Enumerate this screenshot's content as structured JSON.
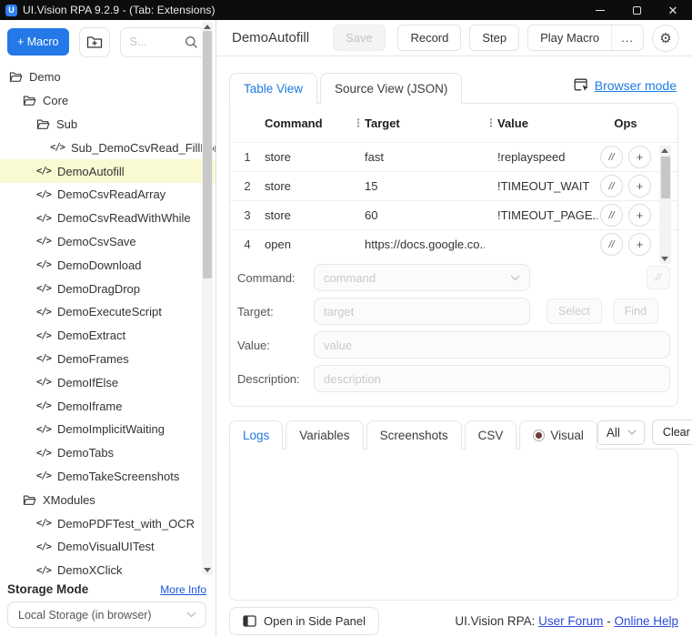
{
  "title_bar": {
    "app_logo_glyph": "U",
    "title": "UI.Vision RPA 9.2.9 - (Tab: Extensions)",
    "window_controls": {
      "minimize": "minimize",
      "maximize": "maximize",
      "close": "✕"
    }
  },
  "colors": {
    "accent_blue": "#2478e8",
    "active_tab_blue": "#1f7ae2",
    "link_blue": "#1e7be2",
    "selected_row_yellow": "#fafad2",
    "visual_radio_maroon": "#6e3b36",
    "titlebar_black": "#0d0d0d"
  },
  "sidebar": {
    "toolbar": {
      "new_macro_label": "+ Macro",
      "search_placeholder": "S..."
    },
    "tree": [
      {
        "label": "Demo",
        "type": "folder",
        "depth": 0
      },
      {
        "label": "Core",
        "type": "folder",
        "depth": 1
      },
      {
        "label": "Sub",
        "type": "folder",
        "depth": 2
      },
      {
        "label": "Sub_DemoCsvRead_FillFor",
        "type": "macro",
        "depth": 3
      },
      {
        "label": "DemoAutofill",
        "type": "macro",
        "depth": 2,
        "selected": true
      },
      {
        "label": "DemoCsvReadArray",
        "type": "macro",
        "depth": 2
      },
      {
        "label": "DemoCsvReadWithWhile",
        "type": "macro",
        "depth": 2
      },
      {
        "label": "DemoCsvSave",
        "type": "macro",
        "depth": 2
      },
      {
        "label": "DemoDownload",
        "type": "macro",
        "depth": 2
      },
      {
        "label": "DemoDragDrop",
        "type": "macro",
        "depth": 2
      },
      {
        "label": "DemoExecuteScript",
        "type": "macro",
        "depth": 2
      },
      {
        "label": "DemoExtract",
        "type": "macro",
        "depth": 2
      },
      {
        "label": "DemoFrames",
        "type": "macro",
        "depth": 2
      },
      {
        "label": "DemoIfElse",
        "type": "macro",
        "depth": 2
      },
      {
        "label": "DemoIframe",
        "type": "macro",
        "depth": 2
      },
      {
        "label": "DemoImplicitWaiting",
        "type": "macro",
        "depth": 2
      },
      {
        "label": "DemoTabs",
        "type": "macro",
        "depth": 2
      },
      {
        "label": "DemoTakeScreenshots",
        "type": "macro",
        "depth": 2
      },
      {
        "label": "XModules",
        "type": "folder",
        "depth": 1
      },
      {
        "label": "DemoPDFTest_with_OCR",
        "type": "macro",
        "depth": 2
      },
      {
        "label": "DemoVisualUITest",
        "type": "macro",
        "depth": 2
      },
      {
        "label": "DemoXClick",
        "type": "macro",
        "depth": 2
      }
    ],
    "macro_icon_glyph": "</>",
    "storage": {
      "heading": "Storage Mode",
      "more_info_label": "More Info",
      "selected_option": "Local Storage (in browser)"
    }
  },
  "header": {
    "macro_title": "DemoAutofill",
    "save_label": "Save",
    "record_label": "Record",
    "step_label": "Step",
    "play_macro_label": "Play Macro",
    "more_label": "...",
    "gear_glyph": "⚙"
  },
  "editor": {
    "tabs": [
      {
        "label": "Table View",
        "active": true
      },
      {
        "label": "Source View (JSON)",
        "active": false
      }
    ],
    "browser_mode_label": "Browser mode",
    "table": {
      "columns": [
        "Command",
        "Target",
        "Value",
        "Ops"
      ],
      "col_separator_glyph": "⋮",
      "ops_buttons": [
        "//",
        "+"
      ],
      "rows": [
        {
          "n": "1",
          "command": "store",
          "target": "fast",
          "value": "!replayspeed"
        },
        {
          "n": "2",
          "command": "store",
          "target": "15",
          "value": "!TIMEOUT_WAIT"
        },
        {
          "n": "3",
          "command": "store",
          "target": "60",
          "value": "!TIMEOUT_PAGE..."
        },
        {
          "n": "4",
          "command": "open",
          "target": "https://docs.google.co...",
          "value": ""
        }
      ]
    },
    "form": {
      "command_label": "Command:",
      "command_placeholder": "command",
      "comment_button_label": "//",
      "target_label": "Target:",
      "target_placeholder": "target",
      "select_label": "Select",
      "find_label": "Find",
      "value_label": "Value:",
      "value_placeholder": "value",
      "description_label": "Description:",
      "description_placeholder": "description"
    }
  },
  "logs_panel": {
    "tabs": [
      {
        "label": "Logs",
        "active": true
      },
      {
        "label": "Variables",
        "active": false
      },
      {
        "label": "Screenshots",
        "active": false
      },
      {
        "label": "CSV",
        "active": false
      }
    ],
    "visual_label": "Visual",
    "visual_radio_selected": true,
    "filter_selected": "All",
    "clear_label": "Clear"
  },
  "footer": {
    "side_panel_label": "Open in Side Panel",
    "brand_label": "UI.Vision RPA:",
    "forum_link": "User Forum",
    "separator": "-",
    "help_link": "Online Help"
  }
}
